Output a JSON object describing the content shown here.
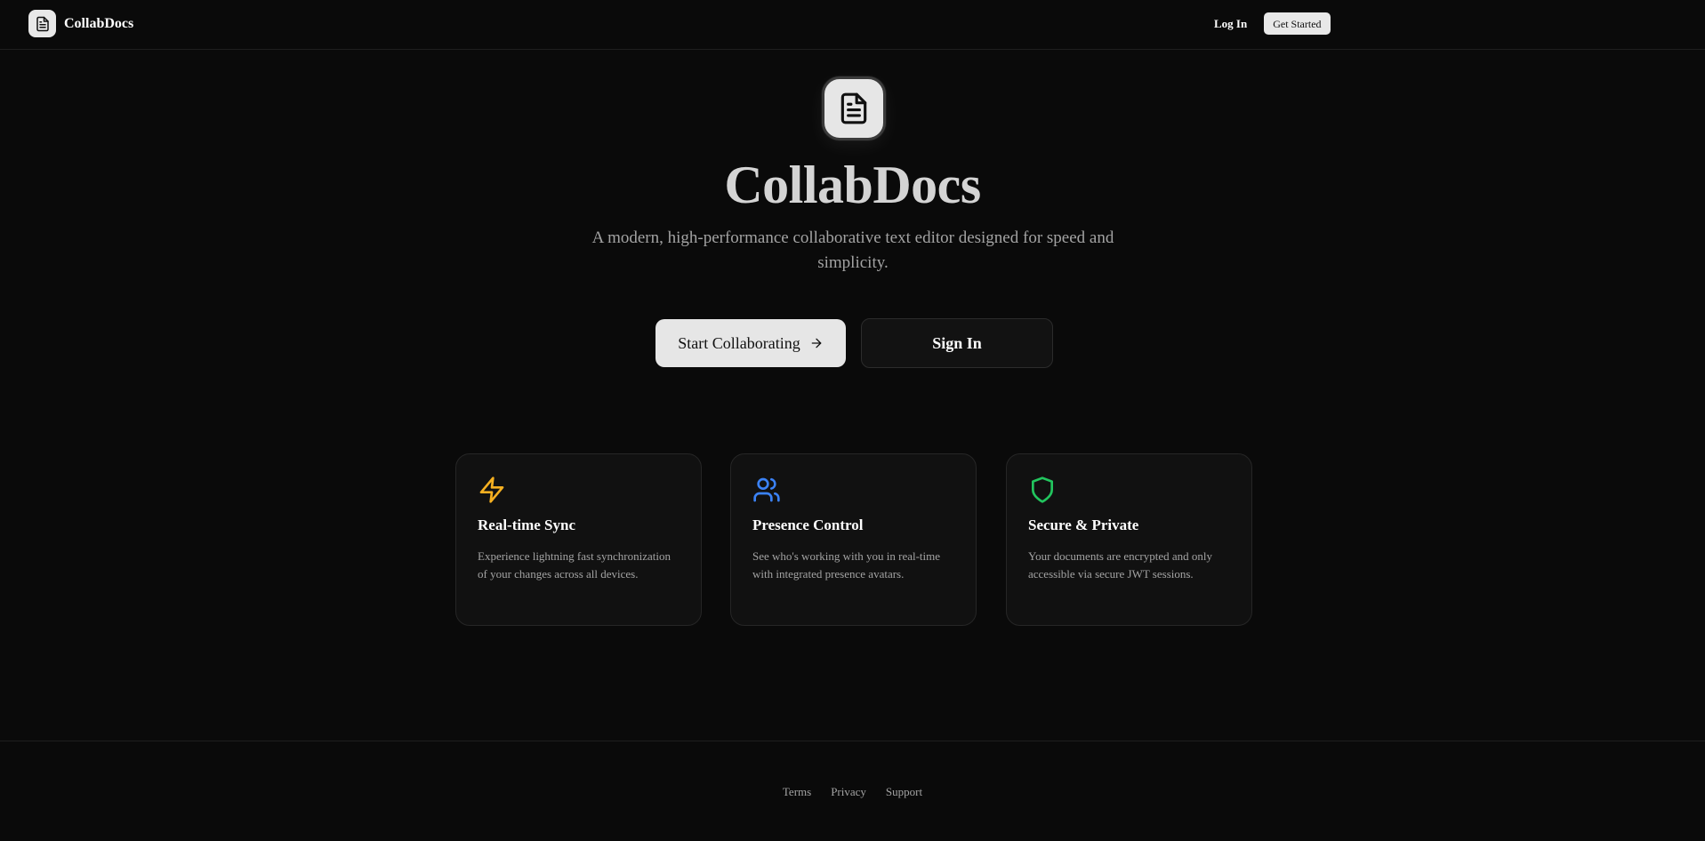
{
  "header": {
    "brand_name": "CollabDocs",
    "login_label": "Log In",
    "get_started_label": "Get Started"
  },
  "hero": {
    "title": "CollabDocs",
    "subtitle": "A modern, high-performance collaborative text editor designed for speed and simplicity.",
    "primary_button_label": "Start Collaborating",
    "secondary_button_label": "Sign In"
  },
  "features": [
    {
      "icon": "lightning-icon",
      "icon_color": "#f5b021",
      "title": "Real-time Sync",
      "description": "Experience lightning fast synchronization of your changes across all devices."
    },
    {
      "icon": "users-icon",
      "icon_color": "#3b82f6",
      "title": "Presence Control",
      "description": "See who's working with you in real-time with integrated presence avatars."
    },
    {
      "icon": "shield-icon",
      "icon_color": "#22c55e",
      "title": "Secure & Private",
      "description": "Your documents are encrypted and only accessible via secure JWT sessions."
    }
  ],
  "footer": {
    "links": [
      "Terms",
      "Privacy",
      "Support"
    ]
  },
  "colors": {
    "background": "#0a0a0a",
    "card_background": "#111111",
    "accent_light": "#e6e6e6"
  }
}
